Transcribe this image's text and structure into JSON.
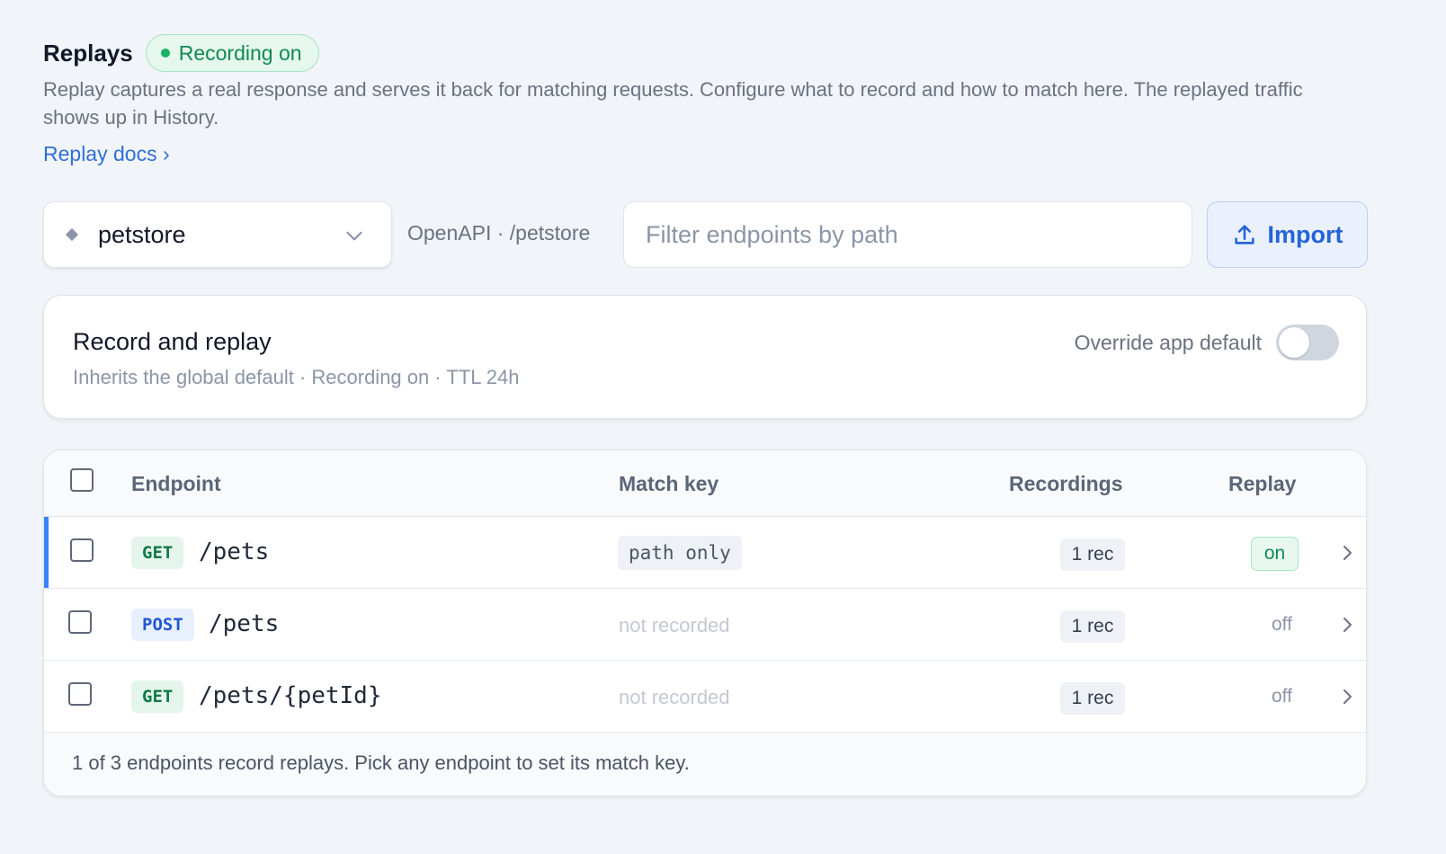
{
  "header": {
    "title": "Replays",
    "status": "Recording on",
    "description": "Replay captures a real response and serves it back for matching requests. Configure what to record and how to match here. The replayed traffic shows up in History.",
    "docs_link": "Replay docs ›"
  },
  "toolbar": {
    "api_name": "petstore",
    "api_meta": "OpenAPI · /petstore",
    "filter_placeholder": "Filter endpoints by path",
    "filter_value": "",
    "import_label": "Import"
  },
  "record_card": {
    "title": "Record and replay",
    "subtitle": "Inherits the global default · Recording on · TTL 24h",
    "override_label": "Override app default",
    "override_enabled": false
  },
  "table": {
    "columns": {
      "endpoint": "Endpoint",
      "match_key": "Match key",
      "recordings": "Recordings",
      "replay": "Replay"
    },
    "rows": [
      {
        "method": "GET",
        "path": "/pets",
        "match_key": "path only",
        "recordings": "1 rec",
        "replay": "on",
        "selected": true
      },
      {
        "method": "POST",
        "path": "/pets",
        "match_key": "not recorded",
        "recordings": "1 rec",
        "replay": "off",
        "selected": false
      },
      {
        "method": "GET",
        "path": "/pets/{petId}",
        "match_key": "not recorded",
        "recordings": "1 rec",
        "replay": "off",
        "selected": false
      }
    ],
    "footer": "1 of 3 endpoints record replays. Pick any endpoint to set its match key."
  },
  "colors": {
    "accent": "#2563d9",
    "status_green": "#0f8a52",
    "selected_bar": "#3b82f6",
    "background": "#f1f4f8"
  },
  "icons": {
    "api": "diamond-icon",
    "select": "chevron-down-icon",
    "import": "upload-icon",
    "row": "chevron-right-icon",
    "status": "dot-icon"
  }
}
